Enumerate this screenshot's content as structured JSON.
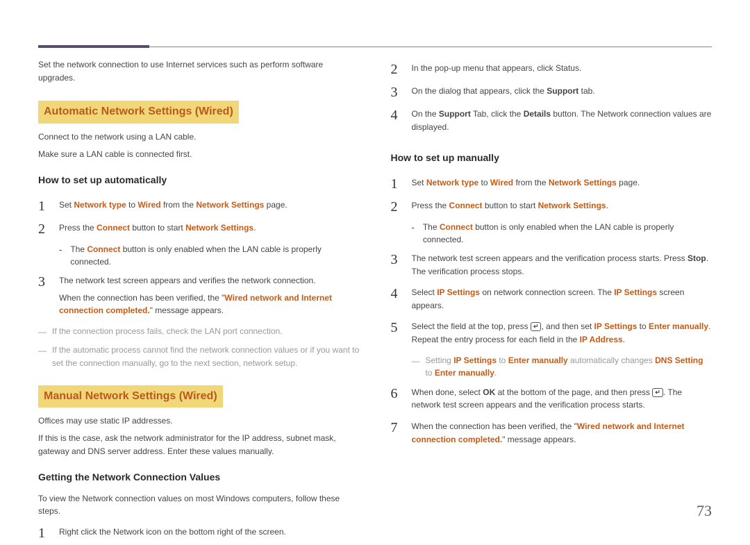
{
  "pageNumber": "73",
  "left": {
    "intro": "Set the network connection to use Internet services such as perform software upgrades.",
    "section1": {
      "title": "Automatic Network Settings (Wired)",
      "line1": "Connect to the network using a LAN cable.",
      "line2": "Make sure a LAN cable is connected first.",
      "sub": "How to set up automatically",
      "step1_a": "Set ",
      "step1_b": "Network type",
      "step1_c": " to ",
      "step1_d": "Wired",
      "step1_e": " from the ",
      "step1_f": "Network Settings",
      "step1_g": " page.",
      "step2_a": "Press the ",
      "step2_b": "Connect",
      "step2_c": " button to start ",
      "step2_d": "Network Settings",
      "step2_e": ".",
      "sub2_a": "The ",
      "sub2_b": "Connect",
      "sub2_c": " button is only enabled when the LAN cable is properly connected.",
      "step3_a": "The network test screen appears and verifies the network connection.",
      "step3_b": "When the connection has been verified, the \"",
      "step3_c": "Wired network and Internet connection completed.",
      "step3_d": "\" message appears.",
      "fn1": "If the connection process fails, check the LAN port connection.",
      "fn2": "If the automatic process cannot find the network connection values or if you want to set the connection manually, go to the next section, network setup."
    },
    "section2": {
      "title": "Manual Network Settings (Wired)",
      "line1": "Offices may use static IP addresses.",
      "line2": "If this is the case, ask the network administrator for the IP address, subnet mask, gateway and DNS server address. Enter these values manually.",
      "sub": "Getting the Network Connection Values",
      "desc": "To view the Network connection values on most Windows computers, follow these steps.",
      "step1": "Right click the Network icon on the bottom right of the screen."
    }
  },
  "right": {
    "r2": "In the pop-up menu that appears, click Status.",
    "r3_a": "On the dialog that appears, click the ",
    "r3_b": "Support",
    "r3_c": " tab.",
    "r4_a": "On the ",
    "r4_b": "Support",
    "r4_c": " Tab, click the ",
    "r4_d": "Details",
    "r4_e": " button. The Network connection values are displayed.",
    "sub": "How to set up manually",
    "m1_a": "Set ",
    "m1_b": "Network type",
    "m1_c": " to ",
    "m1_d": "Wired",
    "m1_e": " from the ",
    "m1_f": "Network Settings",
    "m1_g": " page.",
    "m2_a": "Press the ",
    "m2_b": "Connect",
    "m2_c": " button to start ",
    "m2_d": "Network Settings",
    "m2_e": ".",
    "msub_a": "The ",
    "msub_b": "Connect",
    "msub_c": " button is only enabled when the LAN cable is properly connected.",
    "m3_a": "The network test screen appears and the verification process starts. Press ",
    "m3_b": "Stop",
    "m3_c": ". The verification process stops.",
    "m4_a": "Select ",
    "m4_b": "IP Settings",
    "m4_c": " on network connection screen. The ",
    "m4_d": "IP Settings",
    "m4_e": " screen appears.",
    "m5_a": "Select the field at the top, press ",
    "m5_b": ", and then set ",
    "m5_c": "IP Settings",
    "m5_d": " to ",
    "m5_e": "Enter manually",
    "m5_f": ". Repeat the entry process for each field in the ",
    "m5_g": "IP Address",
    "m5_h": ".",
    "fn_a": "Setting ",
    "fn_b": "IP Settings",
    "fn_c": " to ",
    "fn_d": "Enter manually",
    "fn_e": " automatically changes ",
    "fn_f": "DNS Setting",
    "fn_g": " to ",
    "fn_h": "Enter manually",
    "fn_i": ".",
    "m6_a": "When done, select ",
    "m6_b": "OK",
    "m6_c": " at the bottom of the page, and then press ",
    "m6_d": ". The network test screen appears and the verification process starts.",
    "m7_a": "When the connection has been verified, the \"",
    "m7_b": "Wired network and Internet connection completed.",
    "m7_c": "\" message appears.",
    "enterGlyph": "↵"
  }
}
